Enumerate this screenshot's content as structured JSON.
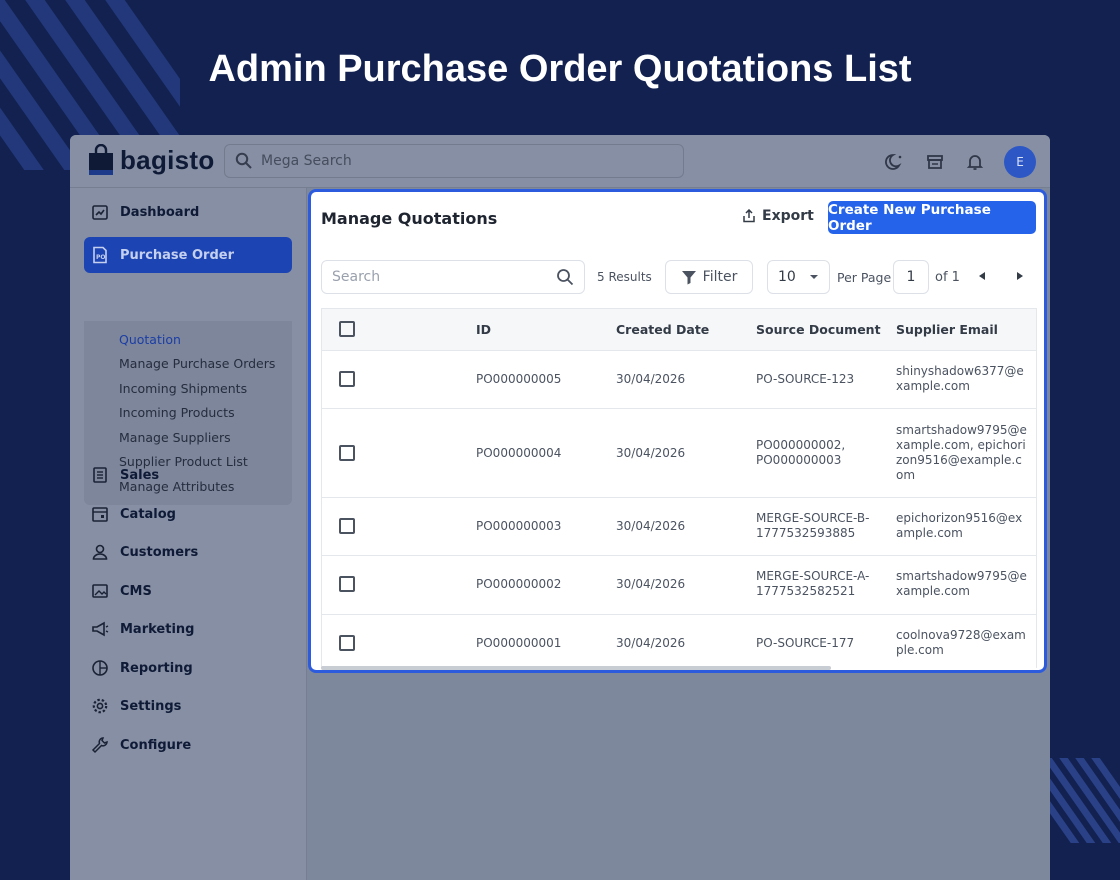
{
  "hero": {
    "title": "Admin Purchase Order Quotations List"
  },
  "brand": {
    "name": "bagisto",
    "accent": "#2563eb"
  },
  "topbar": {
    "search_placeholder": "Mega Search",
    "avatar_initial": "E"
  },
  "sidebar": {
    "items": [
      {
        "label": "Dashboard",
        "icon": "dashboard-icon"
      },
      {
        "label": "Purchase Order",
        "icon": "po-icon",
        "active": true
      },
      {
        "label": "Sales",
        "icon": "sales-icon"
      },
      {
        "label": "Catalog",
        "icon": "catalog-icon"
      },
      {
        "label": "Customers",
        "icon": "customers-icon"
      },
      {
        "label": "CMS",
        "icon": "cms-icon"
      },
      {
        "label": "Marketing",
        "icon": "marketing-icon"
      },
      {
        "label": "Reporting",
        "icon": "reporting-icon"
      },
      {
        "label": "Settings",
        "icon": "settings-icon"
      },
      {
        "label": "Configure",
        "icon": "configure-icon"
      }
    ],
    "sub_items": [
      {
        "label": "Quotation",
        "active": true
      },
      {
        "label": "Manage Purchase Orders"
      },
      {
        "label": "Incoming Shipments"
      },
      {
        "label": "Incoming Products"
      },
      {
        "label": "Manage Suppliers"
      },
      {
        "label": "Supplier Product List"
      },
      {
        "label": "Manage Attributes"
      }
    ]
  },
  "panel": {
    "title": "Manage Quotations",
    "export_label": "Export",
    "create_label": "Create New Purchase Order",
    "search_placeholder": "Search",
    "results": "5 Results",
    "filter_label": "Filter",
    "per_page_value": "10",
    "per_page_label": "Per Page",
    "page_value": "1",
    "page_of": "of 1"
  },
  "table": {
    "columns": [
      "ID",
      "Created Date",
      "Source Document",
      "Supplier Email"
    ],
    "rows": [
      {
        "id": "PO000000005",
        "date": "30/04/2026",
        "source": "PO-SOURCE-123",
        "email": "shinyshadow6377@example.com"
      },
      {
        "id": "PO000000004",
        "date": "30/04/2026",
        "source": "PO000000002, PO000000003",
        "email": "smartshadow9795@example.com, epichorizon9516@example.com"
      },
      {
        "id": "PO000000003",
        "date": "30/04/2026",
        "source": "MERGE-SOURCE-B-1777532593885",
        "email": "epichorizon9516@example.com"
      },
      {
        "id": "PO000000002",
        "date": "30/04/2026",
        "source": "MERGE-SOURCE-A-1777532582521",
        "email": "smartshadow9795@example.com"
      },
      {
        "id": "PO000000001",
        "date": "30/04/2026",
        "source": "PO-SOURCE-177",
        "email": "coolnova9728@example.com"
      }
    ]
  }
}
